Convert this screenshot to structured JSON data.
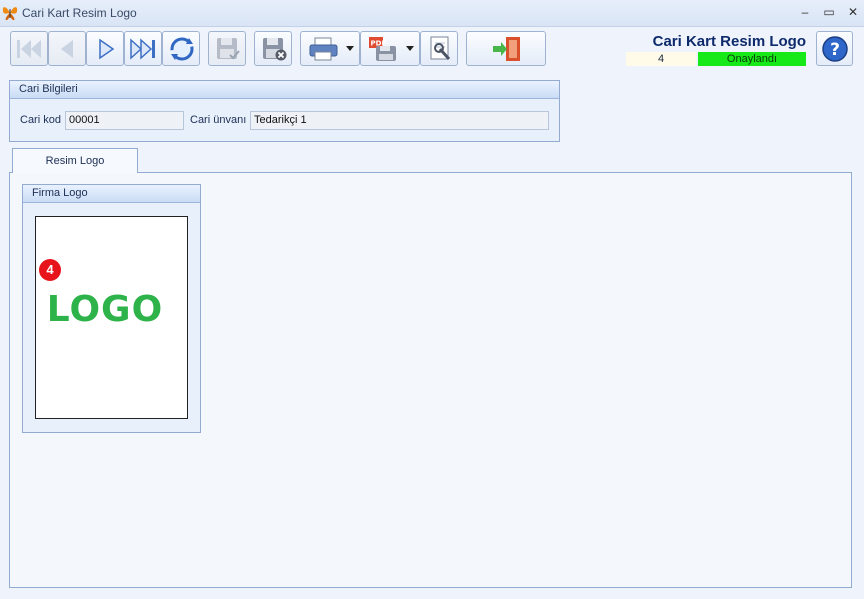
{
  "window": {
    "title": "Cari Kart Resim Logo",
    "controls": {
      "minimize": "‒",
      "maximize": "▭",
      "close": "✕"
    }
  },
  "header": {
    "title": "Cari Kart Resim Logo",
    "record_number": "4",
    "status": "Onaylandı",
    "status_color": "#17e817"
  },
  "toolbar": {
    "icons": [
      "first-record-icon",
      "previous-record-icon",
      "next-record-icon",
      "last-record-icon",
      "refresh-icon",
      "save-icon",
      "delete-icon",
      "print-icon",
      "pdf-export-icon",
      "tools-icon",
      "exit-icon",
      "help-icon"
    ]
  },
  "cari_bilgileri": {
    "title": "Cari Bilgileri",
    "kod_label": "Cari kod",
    "kod_value": "00001",
    "unvan_label": "Cari ünvanı",
    "unvan_value": "Tedarikçi 1"
  },
  "tabs": [
    {
      "label": "Resim Logo"
    }
  ],
  "firma_logo": {
    "title": "Firma Logo",
    "badge": "4",
    "logo_text": "LOGO",
    "logo_color": "#2db34a"
  }
}
